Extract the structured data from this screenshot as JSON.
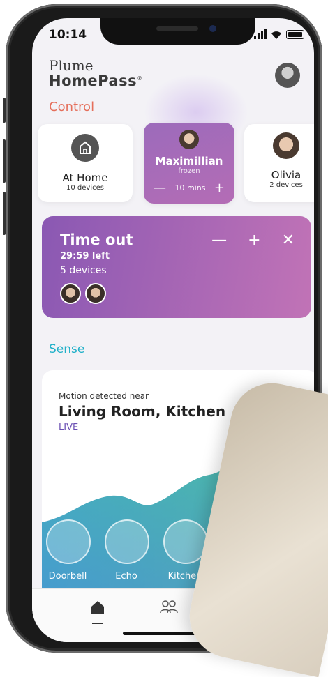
{
  "status": {
    "time": "10:14"
  },
  "brand": {
    "line1": "Plume",
    "line2": "HomePass",
    "mark": "®"
  },
  "control": {
    "section_label": "Control",
    "home": {
      "title": "At Home",
      "subtitle": "10 devices"
    },
    "person_frozen": {
      "name": "Maximillian",
      "status": "frozen",
      "duration": "10 mins"
    },
    "person2": {
      "name": "Olivia",
      "subtitle": "2 devices"
    }
  },
  "timeout": {
    "title": "Time out",
    "time_left": "29:59 left",
    "devices": "5 devices"
  },
  "sense": {
    "section_label": "Sense",
    "motion_label": "Motion detected near",
    "rooms": "Living Room, Kitchen",
    "live": "LIVE",
    "devices": [
      {
        "name": "Doorbell"
      },
      {
        "name": "Echo"
      },
      {
        "name": "Kitchen"
      }
    ]
  },
  "colors": {
    "accent_control": "#e56f5b",
    "accent_sense": "#1fb0c8",
    "timeout_gradient": [
      "#8a58b3",
      "#c173b6"
    ]
  },
  "nav": {
    "icons": [
      "home-icon",
      "people-icon",
      "grid-icon"
    ],
    "active": "home"
  }
}
